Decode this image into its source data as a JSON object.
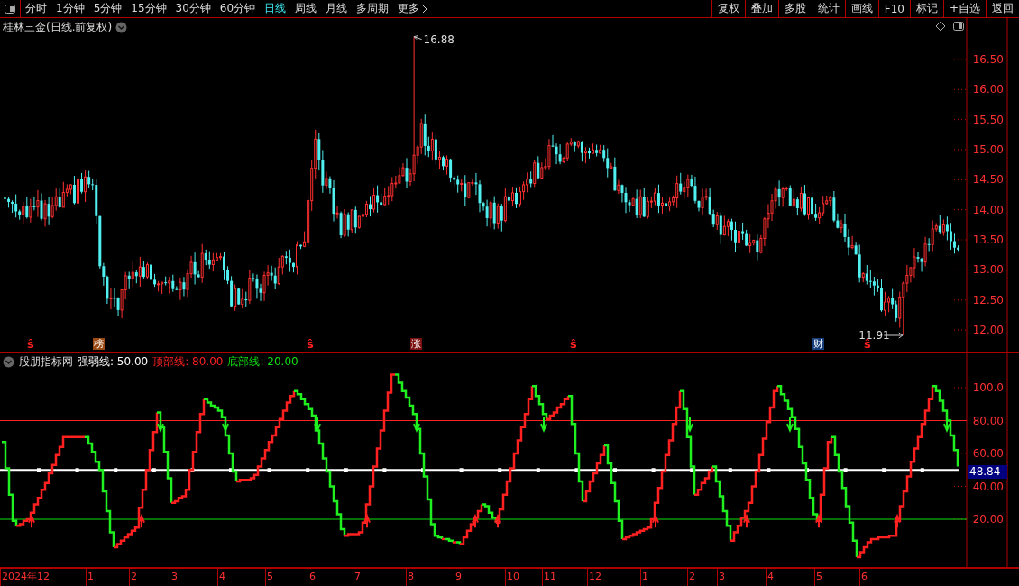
{
  "toolbar": {
    "periods": [
      {
        "label": "分时",
        "selected": false
      },
      {
        "label": "1分钟",
        "selected": false
      },
      {
        "label": "5分钟",
        "selected": false
      },
      {
        "label": "15分钟",
        "selected": false
      },
      {
        "label": "30分钟",
        "selected": false
      },
      {
        "label": "60分钟",
        "selected": false
      },
      {
        "label": "日线",
        "selected": true
      },
      {
        "label": "周线",
        "selected": false
      },
      {
        "label": "月线",
        "selected": false
      },
      {
        "label": "多周期",
        "selected": false
      }
    ],
    "more": "更多",
    "buttons": [
      "复权",
      "叠加",
      "多股",
      "统计",
      "画线",
      "F10",
      "标记",
      "+自选",
      "返回"
    ]
  },
  "stock": {
    "title": "桂林三金(日线.前复权)"
  },
  "price_axis": {
    "ticks": [
      "16.50",
      "16.00",
      "15.50",
      "15.00",
      "14.50",
      "14.00",
      "13.50",
      "13.00",
      "12.50",
      "12.00"
    ]
  },
  "price_labels": {
    "high": "16.88",
    "low": "11.91"
  },
  "markers": [
    {
      "kind": "s",
      "text": "ŝ"
    },
    {
      "kind": "tag",
      "text": "榜",
      "color": "#9a4a12"
    },
    {
      "kind": "s",
      "text": "ŝ"
    },
    {
      "kind": "tag",
      "text": "涨",
      "color": "#7a1010"
    },
    {
      "kind": "s",
      "text": "ŝ"
    },
    {
      "kind": "tag",
      "text": "财",
      "color": "#173d7a"
    },
    {
      "kind": "s",
      "text": "ŝ"
    }
  ],
  "indicator": {
    "name": "股朋指标网",
    "lines": [
      {
        "label": "强弱线:",
        "value": "50.00",
        "color": "#ffffff"
      },
      {
        "label": "顶部线:",
        "value": "80.00",
        "color": "#ff2020"
      },
      {
        "label": "底部线:",
        "value": "20.00",
        "color": "#10e010"
      }
    ],
    "axis_ticks": [
      "100.0",
      "80.00",
      "60.00",
      "40.00",
      "20.00"
    ],
    "current": "48.84"
  },
  "date_axis": [
    "2024年12",
    "1",
    "2",
    "3",
    "4",
    "5",
    "6",
    "7",
    "8",
    "9",
    "10",
    "11",
    "12",
    "1",
    "2",
    "3",
    "4",
    "5",
    "6"
  ]
}
